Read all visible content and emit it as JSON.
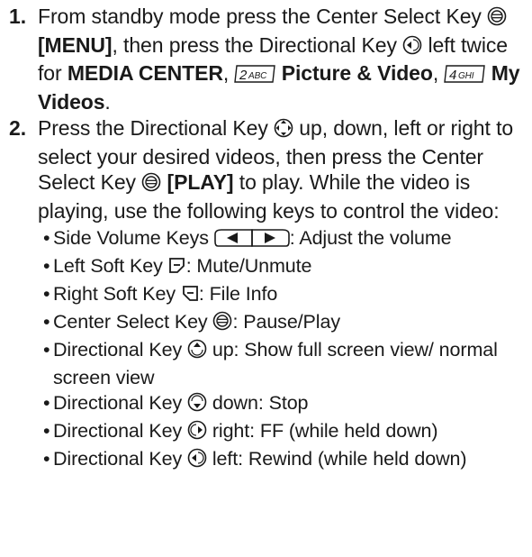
{
  "steps": [
    {
      "number": "1.",
      "t1": "From standby mode press the Center Select Key ",
      "menu_bold": "[MENU]",
      "t2": ", then press the Directional Key ",
      "t3": " left twice for ",
      "media_center": "MEDIA CENTER",
      "t4": ", ",
      "key2_label": "2ABC",
      "picture_video": "Picture & Video",
      "t5": ", ",
      "key4_label": "4GHI",
      "my_videos": "My Videos",
      "t6": "."
    },
    {
      "number": "2.",
      "t1": "Press the Directional Key ",
      "t2": " up, down, left or right to select your desired videos, then press the Center Select Key ",
      "play_bold": "[PLAY]",
      "t3": " to play. While the video is playing, use the following keys to control the video:",
      "bullets": [
        {
          "pre": "Side Volume Keys ",
          "post": ": Adjust the volume",
          "icon": "side-volume-keys-icon"
        },
        {
          "pre": "Left Soft Key ",
          "post": ": Mute/Unmute",
          "icon": "left-soft-key-icon"
        },
        {
          "pre": "Right Soft Key ",
          "post": ": File Info",
          "icon": "right-soft-key-icon"
        },
        {
          "pre": "Center Select Key ",
          "post": ": Pause/Play",
          "icon": "center-select-key-icon"
        },
        {
          "pre": "Directional Key ",
          "post": " up: Show full screen view/ normal screen view",
          "icon": "directional-key-up-icon"
        },
        {
          "pre": "Directional Key ",
          "post": " down: Stop",
          "icon": "directional-key-down-icon"
        },
        {
          "pre": "Directional Key ",
          "post": " right: FF (while held down)",
          "icon": "directional-key-right-icon"
        },
        {
          "pre": "Directional Key ",
          "post": " left: Rewind (while held down)",
          "icon": "directional-key-left-icon"
        }
      ]
    }
  ],
  "bullet_char": "•"
}
